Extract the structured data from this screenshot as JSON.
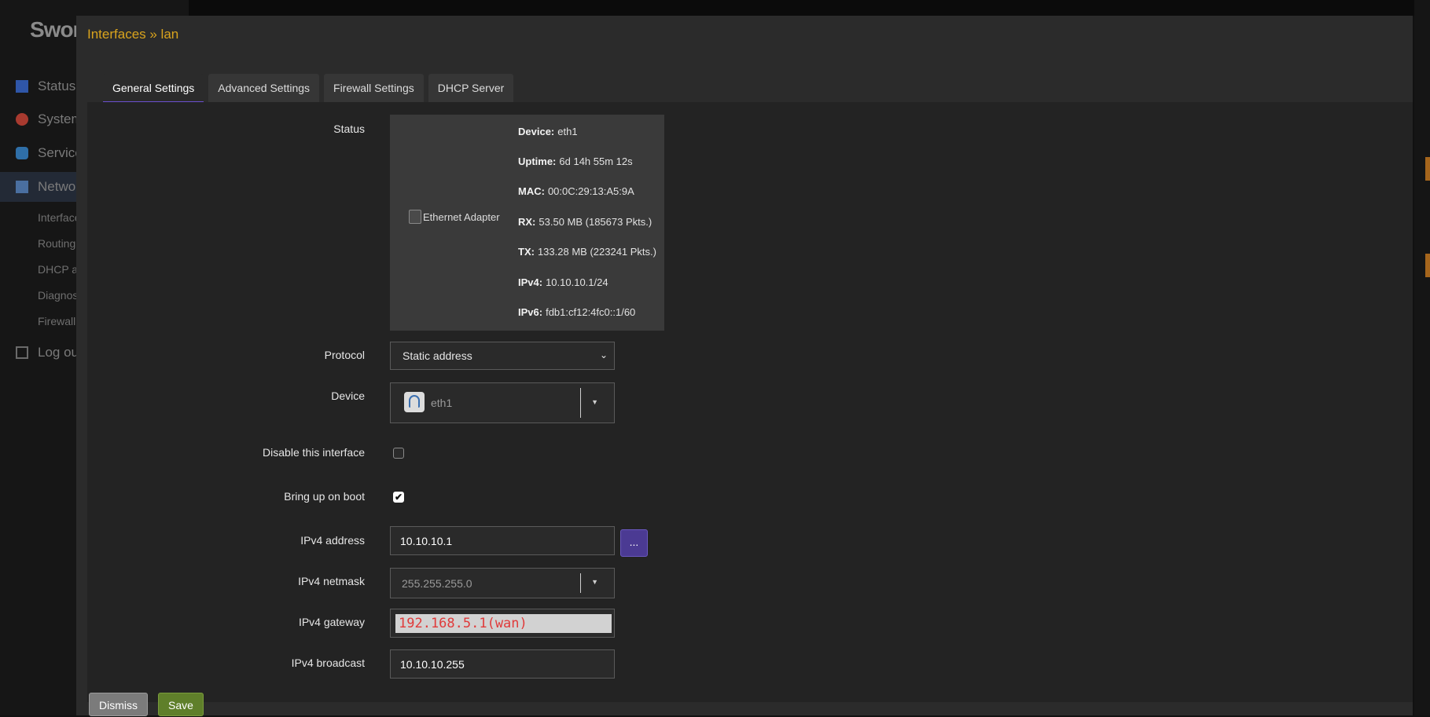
{
  "background": {
    "logo": "Swor",
    "nav": [
      "Status",
      "System",
      "Services",
      "Network"
    ],
    "subnav": [
      "Interfaces",
      "Routing",
      "DHCP a",
      "Diagnos",
      "Firewall"
    ],
    "logout": "Log ou"
  },
  "modal": {
    "title": "Interfaces » lan",
    "tabs": [
      "General Settings",
      "Advanced Settings",
      "Firewall Settings",
      "DHCP Server"
    ],
    "active_tab": "General Settings"
  },
  "status": {
    "label": "Status",
    "adapter_alt": "Ethernet Adapter",
    "rows": [
      {
        "key": "Device:",
        "value": "eth1"
      },
      {
        "key": "Uptime:",
        "value": "6d 14h 55m 12s"
      },
      {
        "key": "MAC:",
        "value": "00:0C:29:13:A5:9A"
      },
      {
        "key": "RX:",
        "value": "53.50 MB (185673 Pkts.)"
      },
      {
        "key": "TX:",
        "value": "133.28 MB (223241 Pkts.)"
      },
      {
        "key": "IPv4:",
        "value": "10.10.10.1/24"
      },
      {
        "key": "IPv6:",
        "value": "fdb1:cf12:4fc0::1/60"
      }
    ]
  },
  "fields": {
    "protocol": {
      "label": "Protocol",
      "value": "Static address"
    },
    "device": {
      "label": "Device",
      "value": "eth1",
      "icon": "ethernet-port-icon"
    },
    "disable": {
      "label": "Disable this interface",
      "checked": false
    },
    "bringup": {
      "label": "Bring up on boot",
      "checked": true
    },
    "ipv4_address": {
      "label": "IPv4 address",
      "value": "10.10.10.1",
      "more_label": "..."
    },
    "ipv4_netmask": {
      "label": "IPv4 netmask",
      "placeholder": "255.255.255.0"
    },
    "ipv4_gateway": {
      "label": "IPv4 gateway",
      "value": "192.168.5.1(wan)"
    },
    "ipv4_broadcast": {
      "label": "IPv4 broadcast",
      "value": "10.10.10.255"
    }
  },
  "buttons": {
    "dismiss": "Dismiss",
    "save": "Save"
  },
  "colors": {
    "title": "#d9a31d",
    "tab_underline": "#6b4fcf",
    "save": "#5f7f2a",
    "dismiss": "#7b7b7b",
    "gateway_text": "#e03a3a"
  }
}
